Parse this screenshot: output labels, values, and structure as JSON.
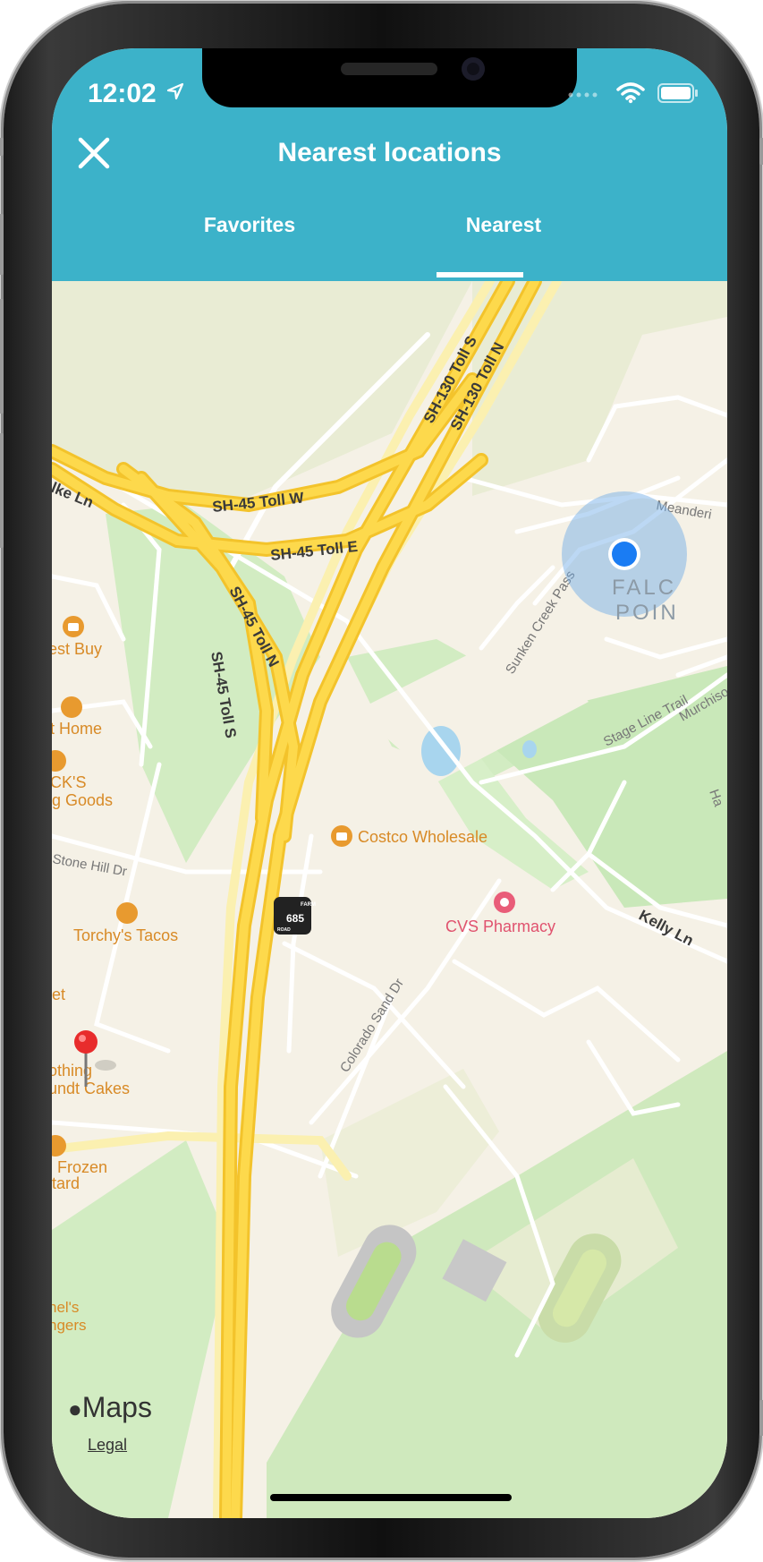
{
  "status_bar": {
    "time": "12:02"
  },
  "header": {
    "title": "Nearest locations",
    "close_icon": "close-icon",
    "tabs": [
      {
        "label": "Favorites",
        "selected": false
      },
      {
        "label": "Nearest",
        "selected": true
      }
    ]
  },
  "map": {
    "roads": {
      "sh130s": "SH-130 Toll S",
      "sh130n": "SH-130 Toll N",
      "sh45w": "SH-45 Toll W",
      "sh45e": "SH-45 Toll E",
      "sh45n": "SH-45 Toll N",
      "sh45s": "SH-45 Toll S",
      "clarke": "lke Ln",
      "stonehill": "Stone Hill Dr",
      "colorado": "Colorado Sand Dr",
      "kelly": "Kelly Ln",
      "sunken": "Sunken Creek Pass",
      "stageline": "Stage Line Trail",
      "meander": "Meanderi",
      "murchison": "Murchiso",
      "ha": "Ha"
    },
    "area_labels": {
      "falcon1": "FALC",
      "falcon2": "POIN"
    },
    "shield_number": "685",
    "shield_top": "FARM",
    "shield_bottom": "ROAD",
    "pois": {
      "bestbuy": "est Buy",
      "athome": "t Home",
      "dicks1": "CK'S",
      "dicks2": "g Goods",
      "costco": "Costco Wholesale",
      "torchys": "Torchy's Tacos",
      "cvs": "CVS Pharmacy",
      "et": "et",
      "bundt1": "othing",
      "bundt2": "undt Cakes",
      "frozen1": "Frozen",
      "frozen2": "tard",
      "angers1": "nel's",
      "angers2": "ngers"
    },
    "colors": {
      "highway": "#fcd43a",
      "poi_orange": "#e89a2f",
      "poi_pink": "#e95d79",
      "user_dot": "#1a7cf3",
      "header": "#3cb2c9"
    }
  },
  "footer": {
    "maps_label": "Maps",
    "legal_label": "Legal"
  }
}
